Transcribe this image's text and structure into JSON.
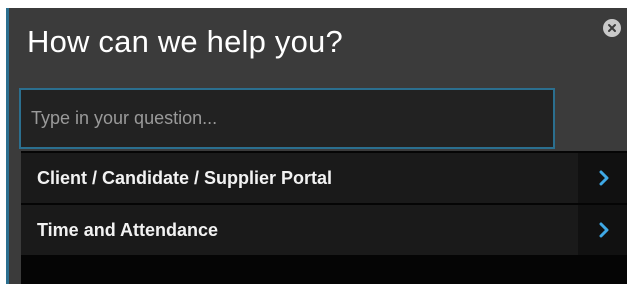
{
  "dialog": {
    "title": "How can we help you?",
    "close_icon": "close-icon"
  },
  "search": {
    "placeholder": "Type in your question..."
  },
  "results": [
    {
      "label": "Client / Candidate / Supplier Portal",
      "icon": "chevron-right-icon"
    },
    {
      "label": "Time and Attendance",
      "icon": "chevron-right-icon"
    }
  ],
  "colors": {
    "panel_bg": "#3b3b3b",
    "accent": "#2b6f8f",
    "input_bg": "#222222",
    "item_bg": "#1a1a1a",
    "chevron": "#3fa9e6",
    "text": "#ffffff"
  }
}
